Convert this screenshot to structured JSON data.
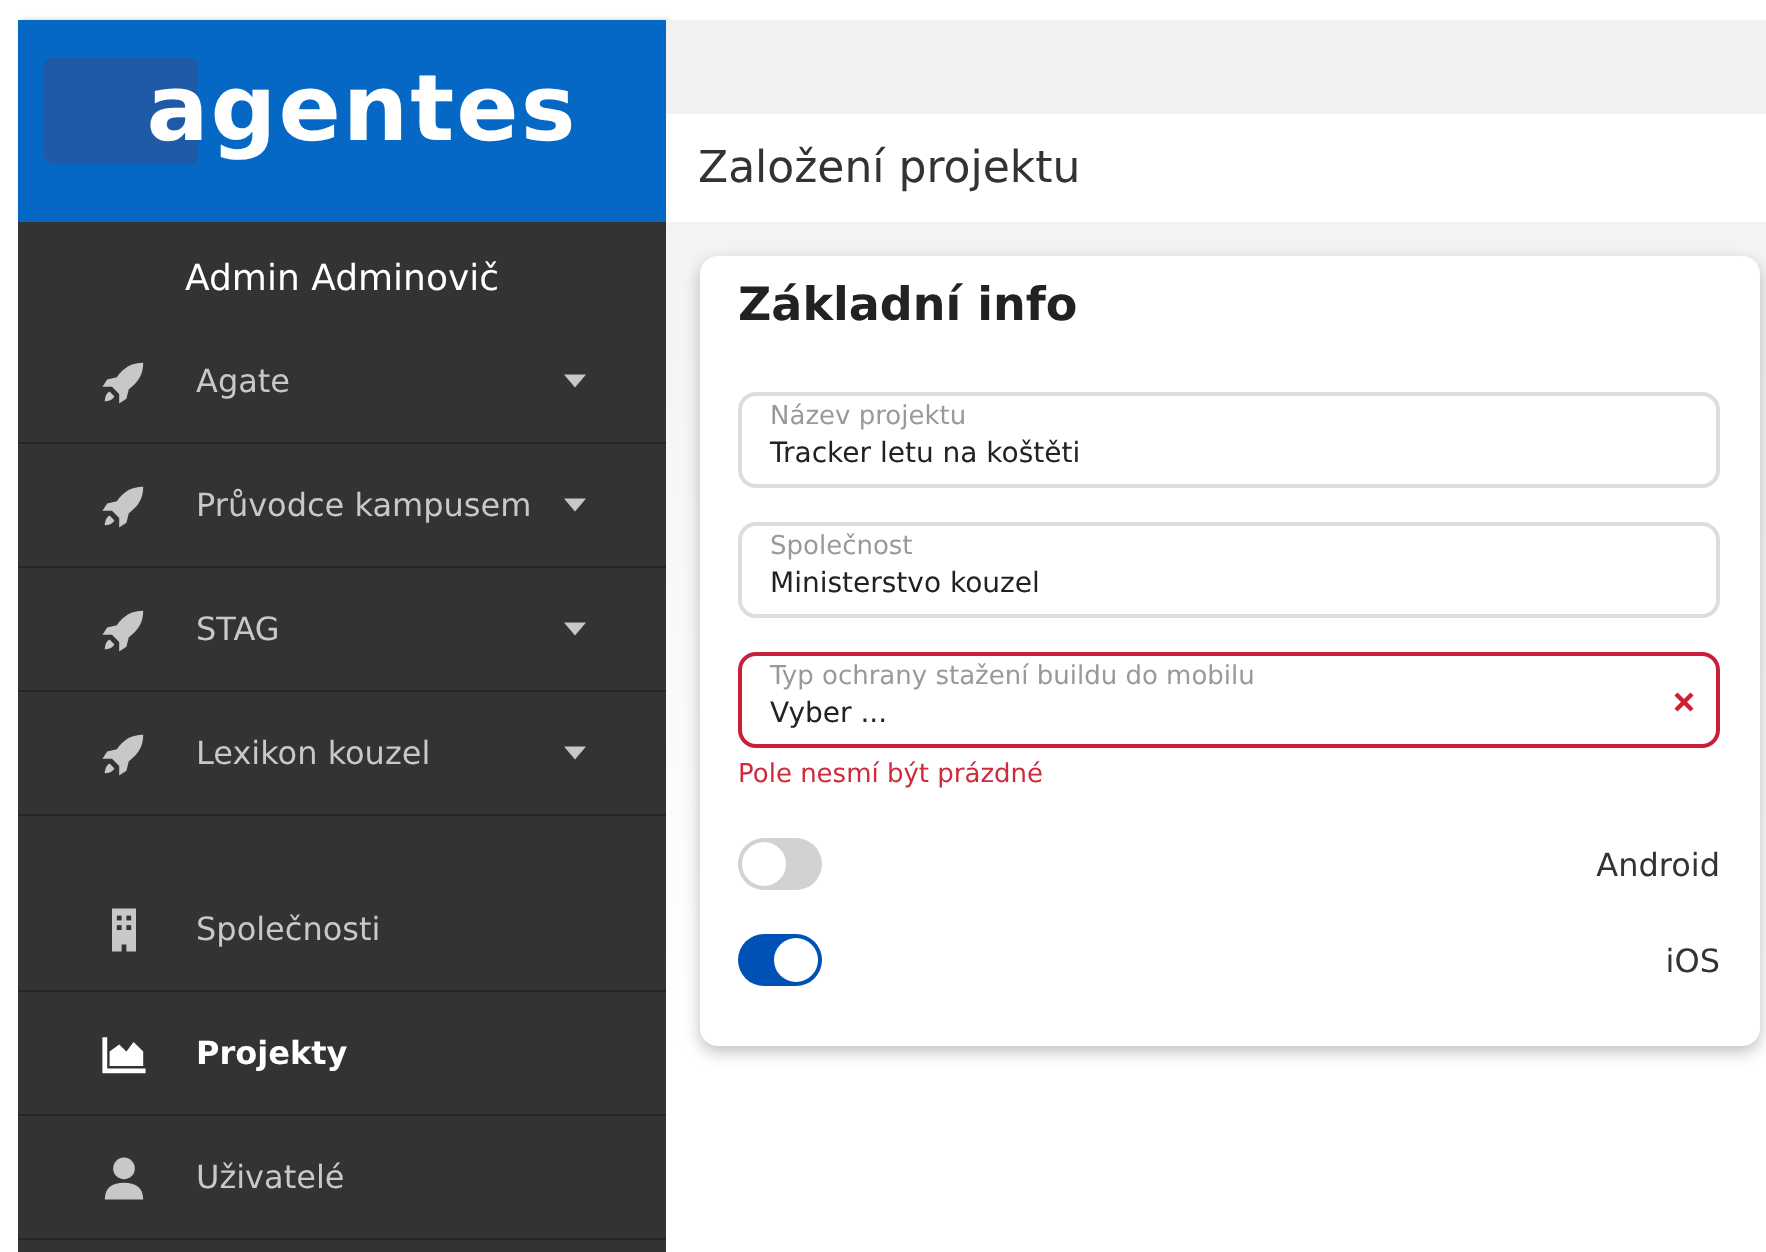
{
  "logo": "agentes",
  "user": "Admin Adminovič",
  "nav": [
    {
      "label": "Agate",
      "kind": "group",
      "selected": false
    },
    {
      "label": "Průvodce kampusem",
      "kind": "group",
      "selected": false
    },
    {
      "label": "STAG",
      "kind": "group",
      "selected": false
    },
    {
      "label": "Lexikon kouzel",
      "kind": "group",
      "selected": false
    },
    {
      "label": "Společnosti",
      "kind": "link",
      "selected": false
    },
    {
      "label": "Projekty",
      "kind": "link",
      "selected": true
    },
    {
      "label": "Uživatelé",
      "kind": "link",
      "selected": false
    }
  ],
  "page_title": "Založení projektu",
  "card": {
    "title": "Základní info",
    "fields": [
      {
        "label": "Název projektu",
        "value": "Tracker letu na koštěti",
        "invalid": false
      },
      {
        "label": "Společnost",
        "value": "Ministerstvo kouzel",
        "invalid": false
      },
      {
        "label": "Typ ochrany stažení buildu do mobilu",
        "value": "Vyber ...",
        "invalid": true,
        "error": "Pole nesmí být prázdné"
      }
    ],
    "toggles": [
      {
        "label": "Android",
        "on": false
      },
      {
        "label": "iOS",
        "on": true
      }
    ]
  }
}
